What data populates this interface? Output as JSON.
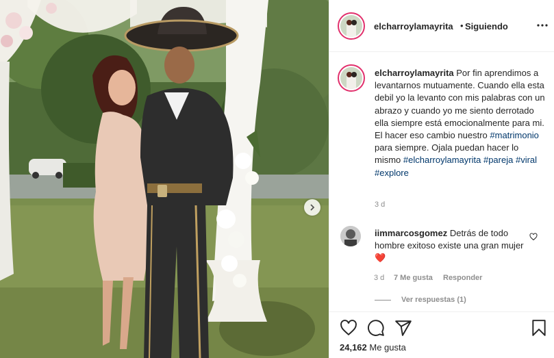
{
  "header": {
    "username": "elcharroylamayrita",
    "separator": "•",
    "follow_status": "Siguiendo"
  },
  "caption": {
    "username": "elcharroylamayrita",
    "text": "Por fin aprendimos a levantarnos mutuamente. Cuando ella esta debil yo la levanto con mis palabras con un abrazo y cuando yo me siento derrotado ella siempre está emocionalmente para mi. El hacer eso cambio nuestro",
    "tag_matrimonio": "#matrimonio",
    "text2": "para siempre. Ojala puedan hacer lo mismo",
    "tags": [
      "#elcharroylamayrita",
      "#pareja",
      "#viral",
      "#explore"
    ],
    "time": "3 d"
  },
  "comment": {
    "username": "iimmarcosgomez",
    "text": "Detrás de todo hombre exitoso existe una gran mujer",
    "emoji": "❤️",
    "time": "3 d",
    "likes": "7 Me gusta",
    "reply": "Responder",
    "view_replies": "Ver respuestas (1)"
  },
  "actions": {
    "like_count": "24,162",
    "like_label": "Me gusta"
  },
  "colors": {
    "accent_link": "#00376b",
    "text": "#262626",
    "muted": "#8e8e8e",
    "story_ring": "#e1306c",
    "heart_red": "#ed4956"
  },
  "icons": [
    "more-options-icon",
    "heart-icon",
    "comment-icon",
    "share-icon",
    "bookmark-icon",
    "chevron-right-icon",
    "comment-like-icon"
  ]
}
